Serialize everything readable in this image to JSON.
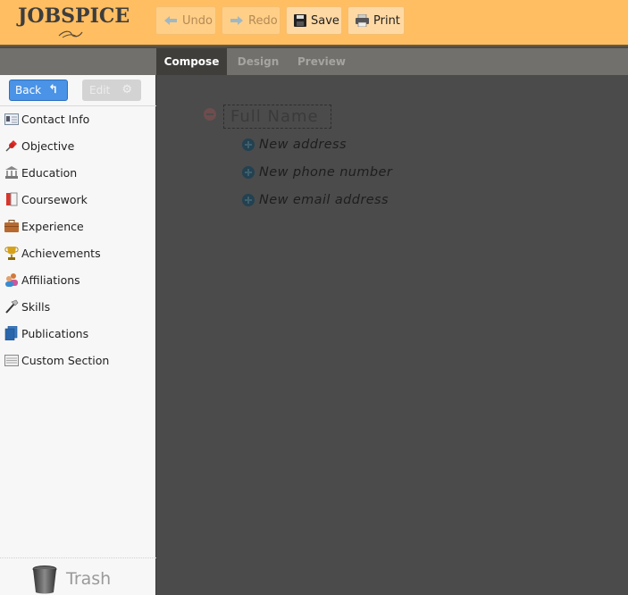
{
  "brand": {
    "name": "JOBSPICE"
  },
  "toolbar": {
    "undo_label": "Undo",
    "redo_label": "Redo",
    "save_label": "Save",
    "print_label": "Print"
  },
  "tabs": [
    {
      "label": "Compose",
      "active": true
    },
    {
      "label": "Design",
      "active": false
    },
    {
      "label": "Preview",
      "active": false
    }
  ],
  "sidebar": {
    "back_label": "Back",
    "edit_label": "Edit",
    "items": [
      {
        "label": "Contact Info",
        "icon": "contact-card-icon"
      },
      {
        "label": "Objective",
        "icon": "pushpin-icon"
      },
      {
        "label": "Education",
        "icon": "bank-building-icon"
      },
      {
        "label": "Coursework",
        "icon": "book-icon"
      },
      {
        "label": "Experience",
        "icon": "briefcase-icon"
      },
      {
        "label": "Achievements",
        "icon": "trophy-icon"
      },
      {
        "label": "Affiliations",
        "icon": "people-icon"
      },
      {
        "label": "Skills",
        "icon": "hammer-icon"
      },
      {
        "label": "Publications",
        "icon": "books-icon"
      },
      {
        "label": "Custom Section",
        "icon": "custom-section-icon"
      }
    ],
    "trash_label": "Trash"
  },
  "canvas": {
    "full_name_placeholder": "Full Name",
    "add_items": [
      "New address",
      "New phone number",
      "New email address"
    ]
  },
  "colors": {
    "topbar": "#ffbe62",
    "tabbar": "#72706c",
    "active_tab": "#3f3e3b",
    "canvas": "#4b4b4b",
    "back_button": "#4a93e6"
  }
}
